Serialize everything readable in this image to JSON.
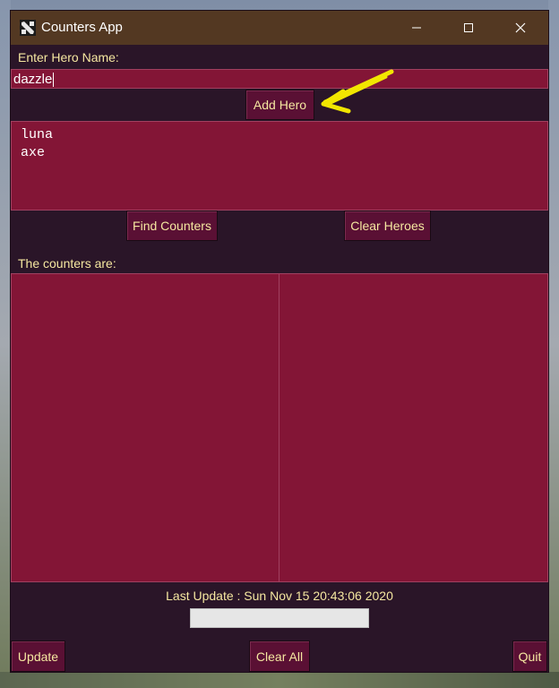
{
  "window": {
    "title": "Counters App",
    "app_icon": "dota-logo-icon"
  },
  "titlebar_controls": {
    "minimize_icon": "minimize-icon",
    "maximize_icon": "maximize-icon",
    "close_icon": "close-icon"
  },
  "hero_input": {
    "label": "Enter Hero Name:",
    "value": "dazzle"
  },
  "add_hero_button": {
    "label": "Add Hero"
  },
  "heroes": [
    "luna",
    "axe"
  ],
  "find_counters_button": {
    "label": "Find Counters"
  },
  "clear_heroes_button": {
    "label": "Clear Heroes"
  },
  "counters": {
    "label": "The counters are:",
    "left_items": [],
    "right_items": []
  },
  "status": {
    "last_update": "Last Update : Sun Nov 15 20:43:06 2020",
    "progress": 0
  },
  "footer": {
    "update_label": "Update",
    "clear_all_label": "Clear All",
    "quit_label": "Quit"
  },
  "colors": {
    "title_bar": "#533822",
    "window_bg": "#2a1528",
    "field_bg": "#831536",
    "button_bg": "#5a1034",
    "label_text": "#f5e7a0",
    "annotation_arrow": "#f2e600"
  }
}
